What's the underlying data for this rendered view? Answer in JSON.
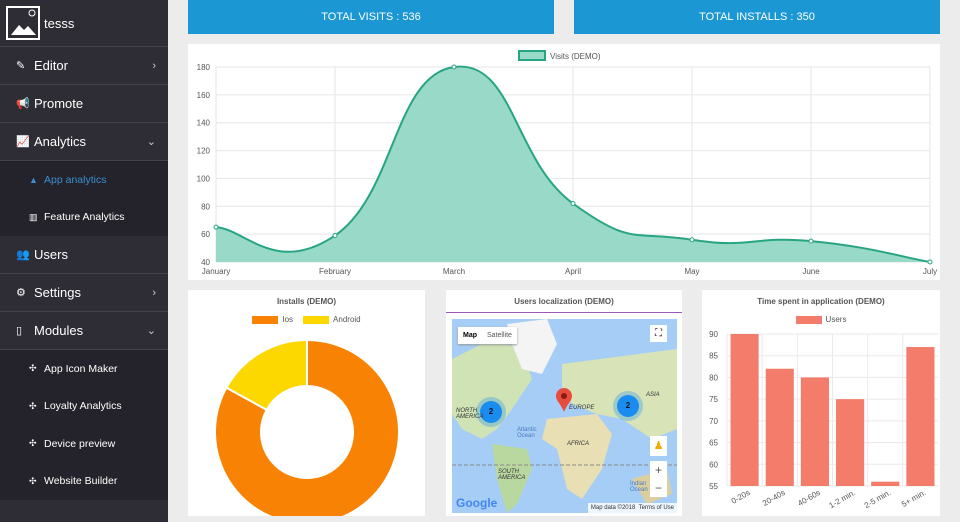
{
  "sidebar": {
    "app_name": "tesss",
    "items": [
      {
        "label": "Editor",
        "icon": "pencil-icon",
        "chevron": "›"
      },
      {
        "label": "Promote",
        "icon": "megaphone-icon"
      },
      {
        "label": "Analytics",
        "icon": "line-chart-icon",
        "chevron": "⌄"
      },
      {
        "label": "App analytics",
        "icon": "area-chart-icon",
        "sub": true,
        "active": true
      },
      {
        "label": "Feature Analytics",
        "icon": "bar-chart-icon",
        "sub": true
      },
      {
        "label": "Users",
        "icon": "users-icon"
      },
      {
        "label": "Settings",
        "icon": "gears-icon",
        "chevron": "›"
      },
      {
        "label": "Modules",
        "icon": "mobile-icon",
        "chevron": "⌄"
      },
      {
        "label": "App Icon Maker",
        "icon": "puzzle-icon",
        "sub": true
      },
      {
        "label": "Loyalty Analytics",
        "icon": "puzzle-icon",
        "sub": true
      },
      {
        "label": "Device preview",
        "icon": "puzzle-icon",
        "sub": true
      },
      {
        "label": "Website Builder",
        "icon": "puzzle-icon",
        "sub": true
      }
    ]
  },
  "stats": {
    "visits": "TOTAL VISITS : 536",
    "installs": "TOTAL INSTALLS : 350"
  },
  "colors": {
    "accent": "#1b98d3",
    "visits_fill": "#98d9c8",
    "visits_line": "#27a582",
    "ios": "#f88203",
    "android": "#fdd700",
    "users_bar": "#f37c6b"
  },
  "chart_data": [
    {
      "type": "area",
      "legend": "Visits (DEMO)",
      "categories": [
        "January",
        "February",
        "March",
        "April",
        "May",
        "June",
        "July"
      ],
      "values": [
        65,
        59,
        180,
        82,
        56,
        55,
        40
      ],
      "ylim": [
        40,
        180
      ],
      "yticks": [
        40,
        60,
        80,
        100,
        120,
        140,
        160,
        180
      ],
      "grid": true,
      "legend_position": "top"
    },
    {
      "type": "pie",
      "title": "Installs (DEMO)",
      "labels": [
        "Ios",
        "Android"
      ],
      "values": [
        83,
        17
      ],
      "legend_position": "top"
    },
    {
      "type": "bar",
      "title": "Time spent in application (DEMO)",
      "legend": "Users",
      "categories": [
        "0-20s",
        "20-40s",
        "40-60s",
        "1-2 min.",
        "2-5 min.",
        "5+ min."
      ],
      "values": [
        90,
        82,
        80,
        75,
        56,
        87
      ],
      "ylim": [
        55,
        90
      ],
      "yticks": [
        55,
        60,
        65,
        70,
        75,
        80,
        85,
        90
      ],
      "grid": true,
      "legend_position": "top"
    }
  ],
  "map": {
    "title": "Users localization (DEMO)",
    "map_btn": "Map",
    "satellite_btn": "Satellite",
    "labels": [
      "NORTH AMERICA",
      "EUROPE",
      "ASIA",
      "AFRICA",
      "SOUTH AMERICA",
      "Atlantic Ocean",
      "Indian Ocean"
    ],
    "clusters": [
      "2",
      "2"
    ],
    "attribution": "Map data ©2018",
    "terms": "Terms of Use",
    "google": "Google",
    "zoom_in": "+",
    "zoom_out": "−"
  }
}
